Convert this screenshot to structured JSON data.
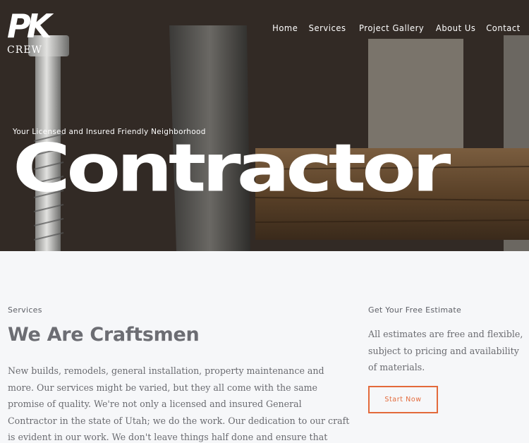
{
  "brand": {
    "logo_mark": "PK",
    "logo_sub": "CREW"
  },
  "nav": {
    "items": [
      "Home",
      "Services",
      "Project Gallery",
      "About Us",
      "Contact"
    ]
  },
  "hero": {
    "tagline": "Your Licensed and Insured Friendly Neighborhood",
    "title": "Contractor"
  },
  "services": {
    "label": "Services",
    "heading": "We Are Craftsmen",
    "body": "New builds, remodels, general installation, property maintenance and more. Our services might be varied, but they all come with the same promise of quality. We're not only a licensed and insured General Contractor in the state of Utah; we do the work. Our dedication to our craft is evident in our work. We don't leave things half done and ensure that everything is up to the quality you expect. We"
  },
  "estimate": {
    "label": "Get Your Free Estimate",
    "body": "All estimates are free and flexible, subject to pricing and availability of materials.",
    "button": "Start Now"
  },
  "colors": {
    "accent": "#e36a3b",
    "heading": "#6c6d73",
    "background": "#f6f7f9"
  }
}
